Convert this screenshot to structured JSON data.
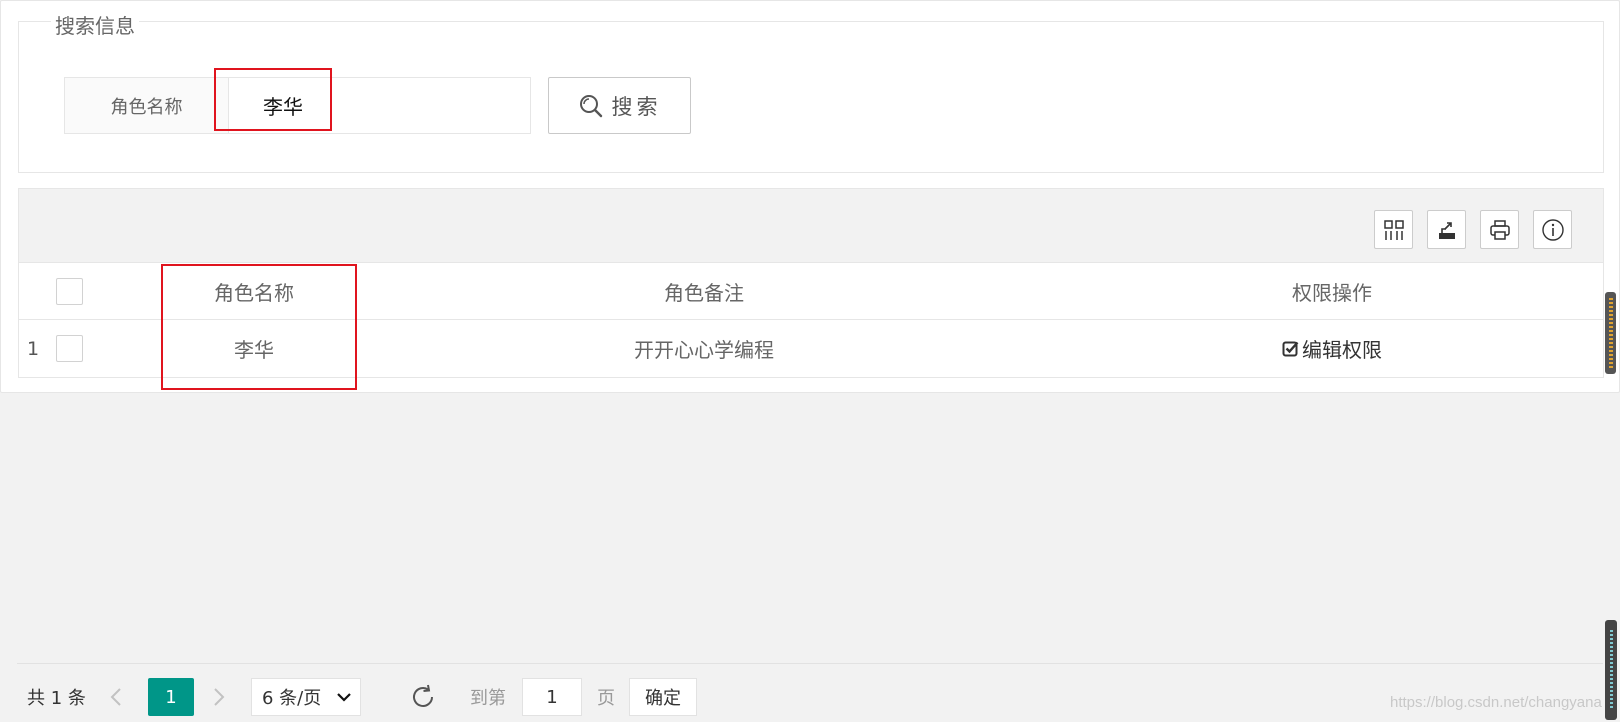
{
  "search": {
    "legend": "搜索信息",
    "field_label": "角色名称",
    "field_value": "李华",
    "button_label": "搜索"
  },
  "toolbar": {
    "icons": [
      "columns-icon",
      "export-icon",
      "print-icon",
      "info-icon"
    ]
  },
  "table": {
    "columns": [
      "角色名称",
      "角色备注",
      "权限操作"
    ],
    "rows": [
      {
        "index": "1",
        "role_name": "李华",
        "remark": "开开心心学编程",
        "action": "编辑权限"
      }
    ]
  },
  "pager": {
    "total": "共 1 条",
    "current_page": "1",
    "page_size": "6 条/页",
    "goto_label": "到第",
    "goto_value": "1",
    "page_label": "页",
    "confirm": "确定"
  },
  "watermark": "https://blog.csdn.net/changyana",
  "colors": {
    "accent": "#009688",
    "highlight": "#e0141e"
  }
}
